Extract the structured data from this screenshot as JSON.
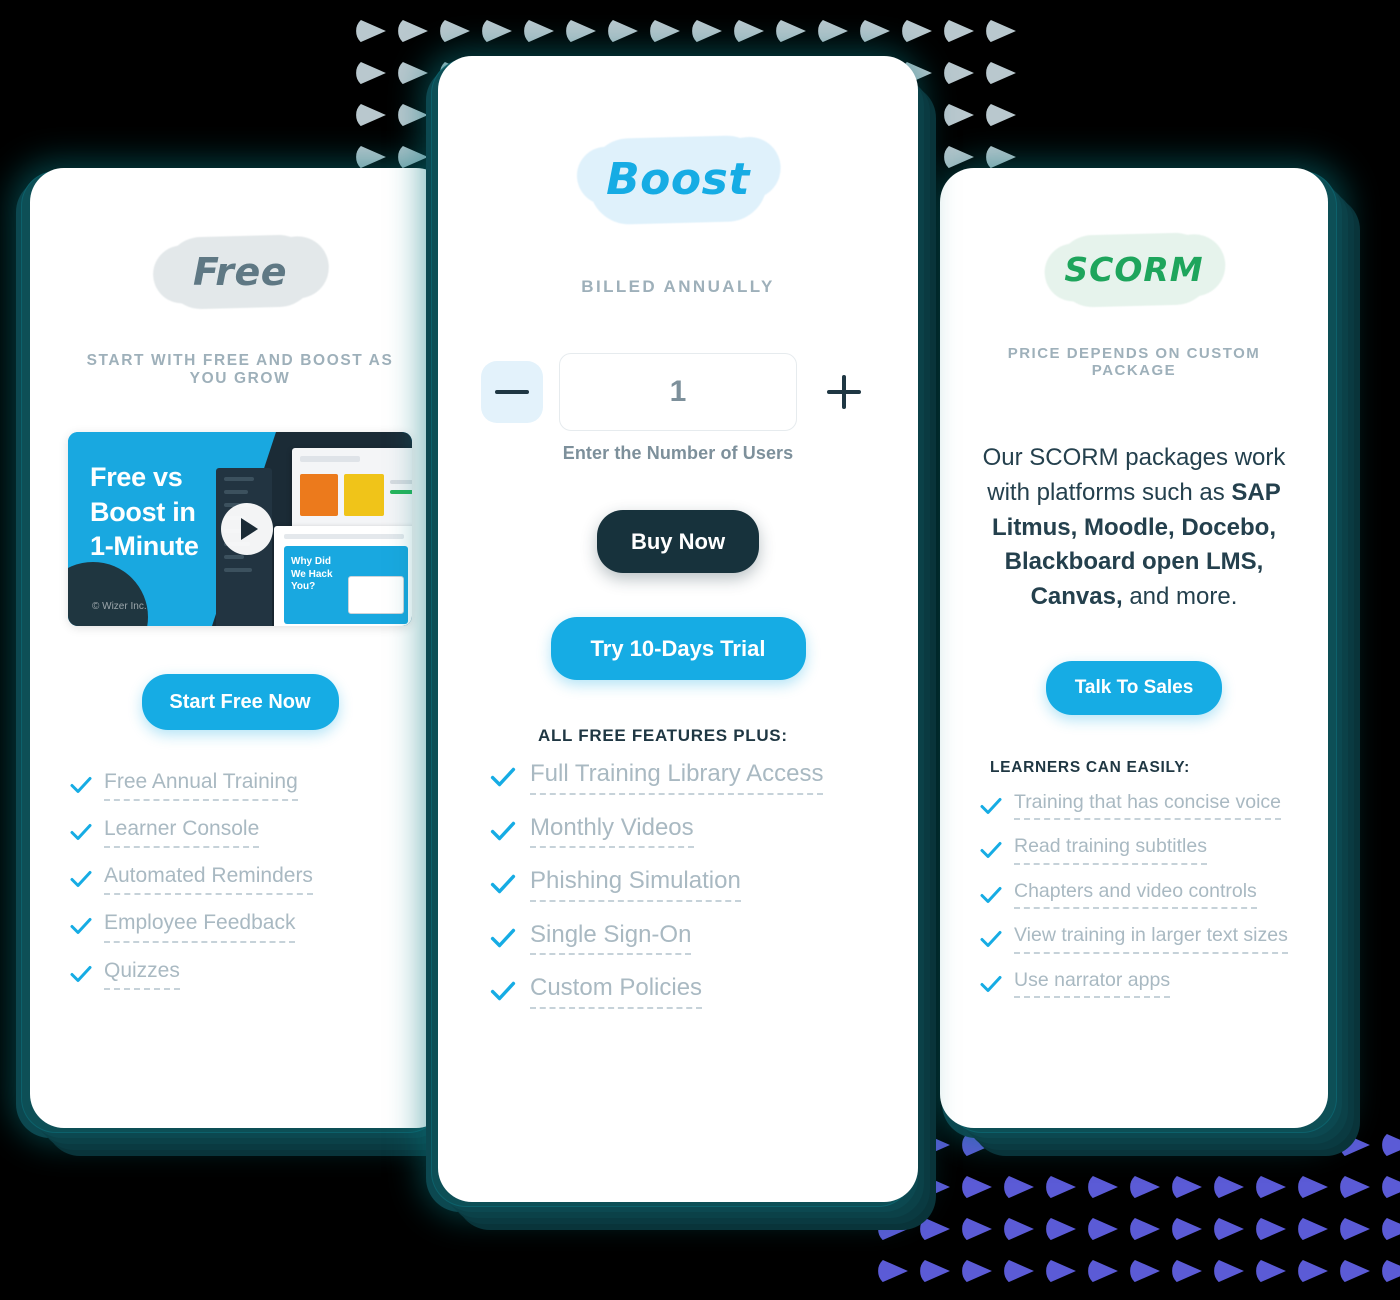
{
  "decor": {
    "top_dots_color": "#b9c8ce",
    "bottom_dots_color": "#5b5bd6",
    "top_dot_count": 64,
    "bottom_dot_count": 52
  },
  "cards": {
    "free": {
      "plan_name": "Free",
      "plan_color": "#5f7884",
      "highlight_color": "#e3e8ea",
      "billing_note": "START WITH FREE AND BOOST AS YOU GROW",
      "video": {
        "title": "Free vs\nBoost in\n1-Minute",
        "title_line1": "Free vs",
        "title_line2": "Boost in",
        "title_line3": "1-Minute",
        "credit": "© Wizer Inc.",
        "inner_headline_line1": "Why Did",
        "inner_headline_line2": "We Hack",
        "inner_headline_line3": "You?",
        "play_icon": "play-icon"
      },
      "cta_label": "Start Free Now",
      "cta_color": "#16ace4",
      "features_heading": "",
      "features": [
        "Free Annual Training",
        "Learner Console",
        "Automated Reminders",
        "Employee Feedback",
        "Quizzes"
      ]
    },
    "boost": {
      "plan_name": "Boost",
      "plan_color": "#16ace4",
      "highlight_color": "#dff1fb",
      "billing_note": "BILLED ANNUALLY",
      "stepper": {
        "minus_label": "−",
        "plus_label": "+",
        "quantity": "1",
        "placeholder": "1",
        "caption": "Enter the Number of Users"
      },
      "primary_cta_label": "Buy Now",
      "primary_cta_color": "#17323c",
      "secondary_cta_label": "Try 10-Days Trial",
      "secondary_cta_color": "#16ace4",
      "features_heading": "ALL FREE FEATURES PLUS:",
      "features": [
        "Full Training Library Access",
        "Monthly Videos",
        "Phishing Simulation",
        "Single Sign-On",
        "Custom Policies"
      ]
    },
    "scorm": {
      "plan_name": "SCORM",
      "plan_color": "#1ea55c",
      "highlight_color": "#e6f3ec",
      "billing_note": "PRICE DEPENDS ON CUSTOM PACKAGE",
      "description_parts": [
        {
          "text": "Our SCORM packages work with platforms such as ",
          "bold": false
        },
        {
          "text": "SAP Litmus, Moodle, Docebo, Blackboard open LMS, Canvas,",
          "bold": true
        },
        {
          "text": " and more.",
          "bold": false
        }
      ],
      "cta_label": "Talk To Sales",
      "cta_color": "#16ace4",
      "features_heading": "LEARNERS CAN EASILY:",
      "features": [
        "Training that has concise voice",
        "Read training subtitles",
        "Chapters and video controls",
        "View training in larger text sizes",
        "Use narrator apps"
      ]
    }
  }
}
